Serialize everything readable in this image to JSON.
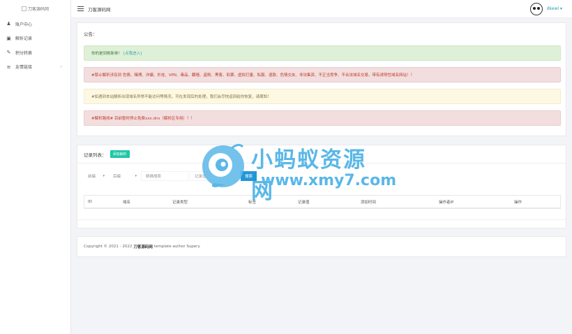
{
  "sidebar": {
    "logo_alt": "刀客源码网",
    "items": [
      {
        "label": "账户中心",
        "icon": "user-icon"
      },
      {
        "label": "解析记录",
        "icon": "record-icon"
      },
      {
        "label": "积分转换",
        "icon": "pencil-icon"
      },
      {
        "label": "友情链接",
        "icon": "list-icon"
      }
    ]
  },
  "topbar": {
    "title": "刀客源码网",
    "username": "dkewl"
  },
  "notice": {
    "heading": "公告：",
    "success_text": "你的是到刷新券！",
    "success_link": "[点我进入]",
    "danger1_text": "#禁止解析涉及到 色情、赌博、诈骗、外挂、VPN、毒品、翻墙、盗刷、黑客、彩票、虚拟打量、私服、退款、色情交友、非法集资、不正当竞争、不合法域名交易、带有诱导性域名网站！！",
    "warning_text": "#如遇到本站解析出现域名异常不能访问等情况，可在发现后的处理，我们会尽快返回给你恢复，请周知！",
    "danger2_text": "#解析路线# 目前暂时停止免费xxx.dns（解析区专用）！！"
  },
  "list": {
    "title": "记录列表：",
    "add_button": "添加解析",
    "filters": {
      "select1": "前缀",
      "select2": "后缀",
      "input1_placeholder": "精确搜索",
      "input2_placeholder": "记录值",
      "search_button": "搜索"
    },
    "columns": [
      "ID",
      "域名",
      "记录类型",
      "标签",
      "记录值",
      "添加时间",
      "操作者IP",
      "操作"
    ]
  },
  "footer": {
    "prefix": "Copyright © 2021 - 2022",
    "brand": "刀客源码网",
    "suffix": "template author Supery"
  },
  "watermark": {
    "line1": "小蚂蚁资源网",
    "line2": "www.xmy7.com"
  },
  "colors": {
    "accent": "#1fc6a7",
    "primary": "#2196d8",
    "watermark": "#5ab7e8"
  }
}
